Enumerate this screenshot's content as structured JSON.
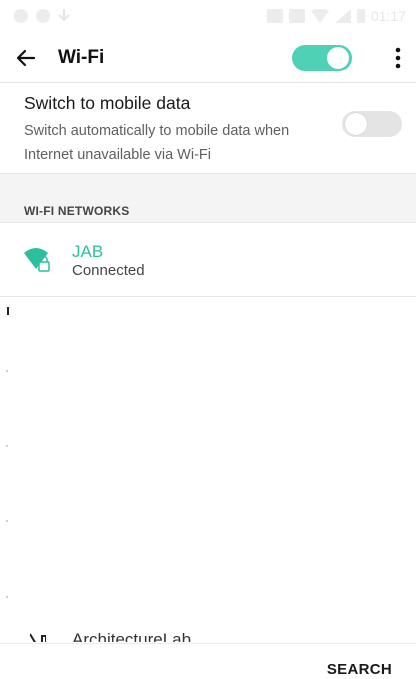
{
  "status_bar": {
    "time": "01:17",
    "icons": [
      "notification-icon",
      "notification-icon",
      "download-icon",
      "sim-icon",
      "alarm-icon",
      "wifi-signal-icon",
      "cell-signal-icon",
      "battery-icon"
    ]
  },
  "app_bar": {
    "back_icon": "back-arrow-icon",
    "title": "Wi-Fi",
    "wifi_enabled": true,
    "more_icon": "more-vert-icon"
  },
  "mobile_data": {
    "title": "Switch to mobile data",
    "summary": "Switch automatically to mobile data when Internet unavailable via Wi-Fi",
    "enabled": false
  },
  "networks_section": {
    "label": "WI-FI NETWORKS"
  },
  "networks": [
    {
      "name": "JAB",
      "status": "Connected",
      "icon": "wifi-locked-icon",
      "connected": true
    }
  ],
  "partially_visible_network": {
    "name": "ArchitectureLab",
    "icon": "wifi-locked-icon"
  },
  "bottom_bar": {
    "search_label": "SEARCH"
  },
  "colors": {
    "accent": "#4fd1b5",
    "connected_text": "#2dbf9c"
  }
}
